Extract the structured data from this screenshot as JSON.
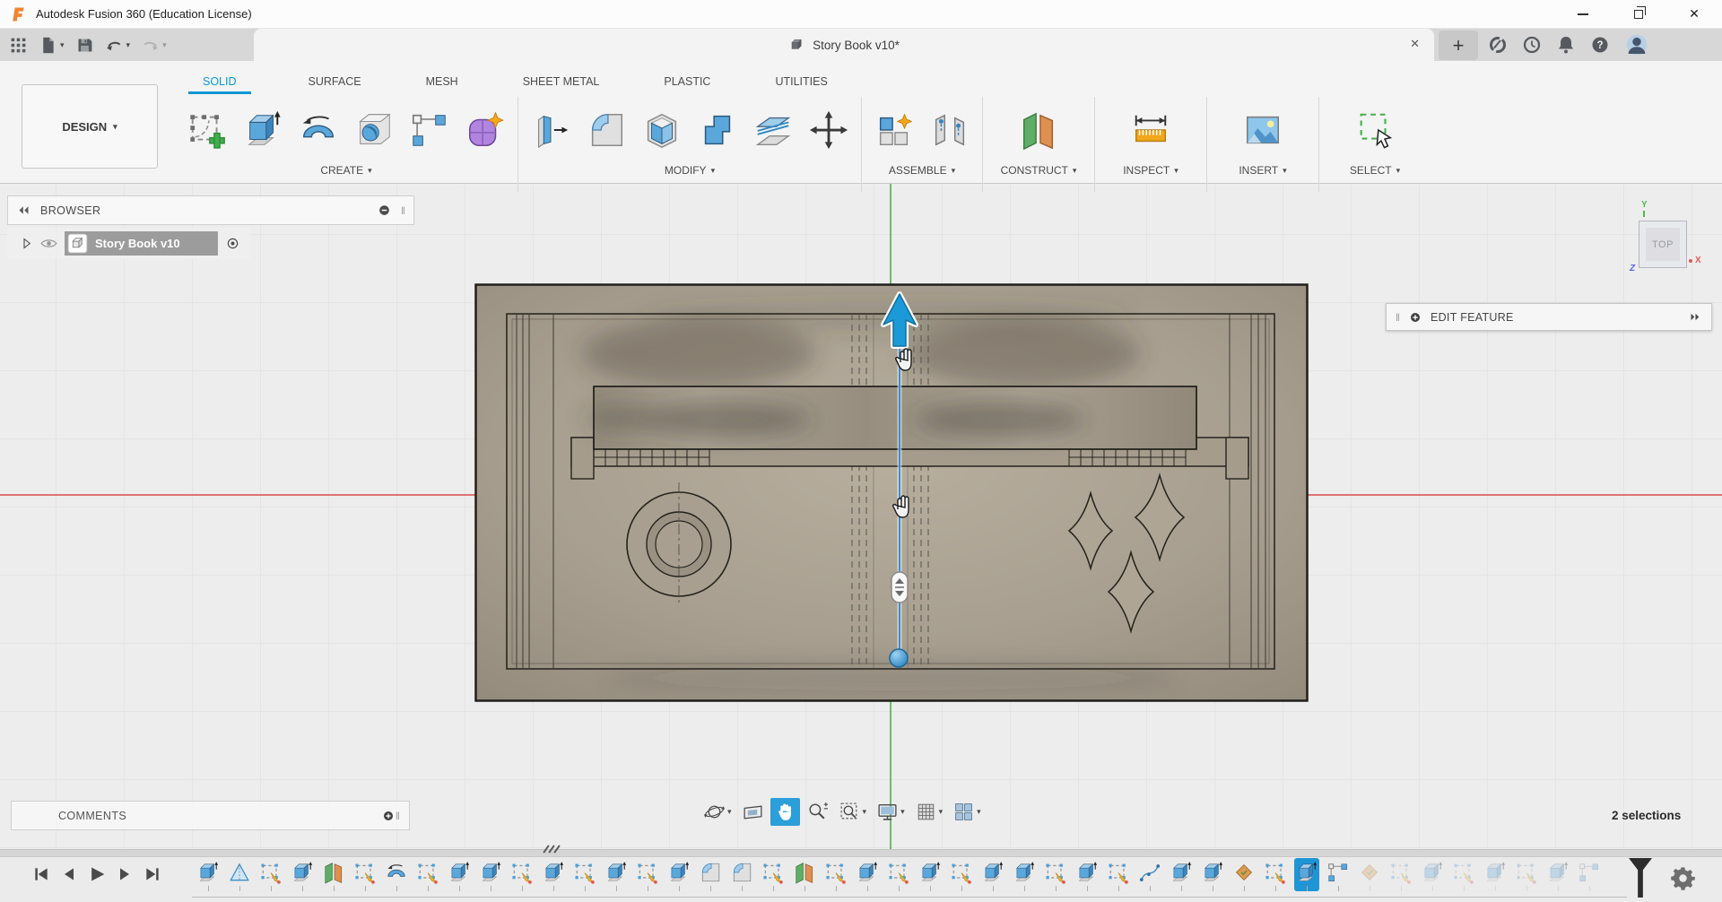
{
  "colors": {
    "accent_blue": "#0a97d5",
    "selection_blue": "#1e95d5",
    "model_tan": "#a89f90",
    "axis_red": "#d95454",
    "axis_green": "#60b660",
    "select_green": "#43b049"
  },
  "title_bar": {
    "app_title": "Autodesk Fusion 360 (Education License)"
  },
  "quick_access": {
    "items": [
      {
        "name": "app-grid",
        "dropdown": false,
        "disabled": false
      },
      {
        "name": "file",
        "dropdown": true,
        "disabled": false
      },
      {
        "name": "save",
        "dropdown": false,
        "disabled": false
      },
      {
        "name": "undo",
        "dropdown": true,
        "disabled": false
      },
      {
        "name": "redo",
        "dropdown": true,
        "disabled": true
      }
    ]
  },
  "document_tabs": {
    "active_tab": "Story Book v10*",
    "new_tab_label": "+"
  },
  "account_icons": [
    {
      "name": "extensions"
    },
    {
      "name": "job-status"
    },
    {
      "name": "notifications"
    },
    {
      "name": "help"
    },
    {
      "name": "profile"
    }
  ],
  "ribbon": {
    "workspace_selector": "DESIGN",
    "tabs": [
      {
        "label": "SOLID",
        "active": true
      },
      {
        "label": "SURFACE",
        "active": false
      },
      {
        "label": "MESH",
        "active": false
      },
      {
        "label": "SHEET METAL",
        "active": false
      },
      {
        "label": "PLASTIC",
        "active": false
      },
      {
        "label": "UTILITIES",
        "active": false
      }
    ],
    "groups": [
      {
        "label": "CREATE",
        "tools": [
          {
            "name": "create-sketch"
          },
          {
            "name": "extrude"
          },
          {
            "name": "revolve"
          },
          {
            "name": "hole"
          },
          {
            "name": "rectangular-pattern"
          },
          {
            "name": "form"
          }
        ]
      },
      {
        "label": "MODIFY",
        "tools": [
          {
            "name": "press-pull"
          },
          {
            "name": "fillet"
          },
          {
            "name": "shell"
          },
          {
            "name": "combine"
          },
          {
            "name": "offset-face"
          },
          {
            "name": "move-copy"
          }
        ]
      },
      {
        "label": "ASSEMBLE",
        "tools": [
          {
            "name": "new-component"
          },
          {
            "name": "joint"
          }
        ]
      },
      {
        "label": "CONSTRUCT",
        "tools": [
          {
            "name": "construction-plane"
          }
        ]
      },
      {
        "label": "INSPECT",
        "tools": [
          {
            "name": "measure"
          }
        ]
      },
      {
        "label": "INSERT",
        "tools": [
          {
            "name": "insert-canvas"
          }
        ]
      },
      {
        "label": "SELECT",
        "tools": [
          {
            "name": "select"
          }
        ]
      }
    ]
  },
  "browser": {
    "header": "BROWSER",
    "root_item": "Story Book v10"
  },
  "canvas": {
    "viewcube_face": "TOP",
    "axes": {
      "x": "X",
      "y": "Y",
      "z": "Z"
    }
  },
  "edit_feature_panel": {
    "title": "EDIT FEATURE"
  },
  "comments_panel": {
    "title": "COMMENTS"
  },
  "navigation_bar": {
    "tools": [
      {
        "name": "orbit",
        "dropdown": true,
        "active": false
      },
      {
        "name": "look-at",
        "dropdown": false,
        "active": false
      },
      {
        "name": "pan",
        "dropdown": false,
        "active": true
      },
      {
        "name": "zoom",
        "dropdown": false,
        "active": false
      },
      {
        "name": "fit",
        "dropdown": true,
        "active": false
      },
      {
        "name": "display-settings",
        "dropdown": true,
        "active": false
      },
      {
        "name": "grid-snaps",
        "dropdown": true,
        "active": false
      },
      {
        "name": "viewports",
        "dropdown": true,
        "active": false
      }
    ]
  },
  "status": {
    "selection_count": "2 selections"
  },
  "timeline": {
    "playback_controls": [
      "go-to-start",
      "step-back",
      "play",
      "step-forward",
      "go-to-end"
    ],
    "features": [
      {
        "type": "extrude"
      },
      {
        "type": "mirror"
      },
      {
        "type": "sketch"
      },
      {
        "type": "extrude"
      },
      {
        "type": "plane"
      },
      {
        "type": "sketch"
      },
      {
        "type": "revolve"
      },
      {
        "type": "sketch"
      },
      {
        "type": "extrude"
      },
      {
        "type": "extrude"
      },
      {
        "type": "sketch"
      },
      {
        "type": "extrude"
      },
      {
        "type": "sketch"
      },
      {
        "type": "extrude"
      },
      {
        "type": "sketch"
      },
      {
        "type": "extrude"
      },
      {
        "type": "fillet"
      },
      {
        "type": "fillet"
      },
      {
        "type": "sketch"
      },
      {
        "type": "plane"
      },
      {
        "type": "sketch"
      },
      {
        "type": "extrude"
      },
      {
        "type": "sketch"
      },
      {
        "type": "extrude"
      },
      {
        "type": "sketch"
      },
      {
        "type": "extrude"
      },
      {
        "type": "extrude"
      },
      {
        "type": "sketch"
      },
      {
        "type": "extrude"
      },
      {
        "type": "sketch"
      },
      {
        "type": "spline"
      },
      {
        "type": "extrude"
      },
      {
        "type": "extrude"
      },
      {
        "type": "emboss"
      },
      {
        "type": "sketch"
      },
      {
        "type": "extrude",
        "state": "selected"
      },
      {
        "type": "pattern"
      },
      {
        "type": "emboss",
        "state": "suppressed"
      },
      {
        "type": "sketch",
        "state": "suppressed"
      },
      {
        "type": "extrude",
        "state": "suppressed"
      },
      {
        "type": "sketch",
        "state": "suppressed"
      },
      {
        "type": "extrude",
        "state": "suppressed"
      },
      {
        "type": "sketch",
        "state": "suppressed"
      },
      {
        "type": "extrude",
        "state": "suppressed"
      },
      {
        "type": "pattern",
        "state": "suppressed"
      }
    ]
  }
}
